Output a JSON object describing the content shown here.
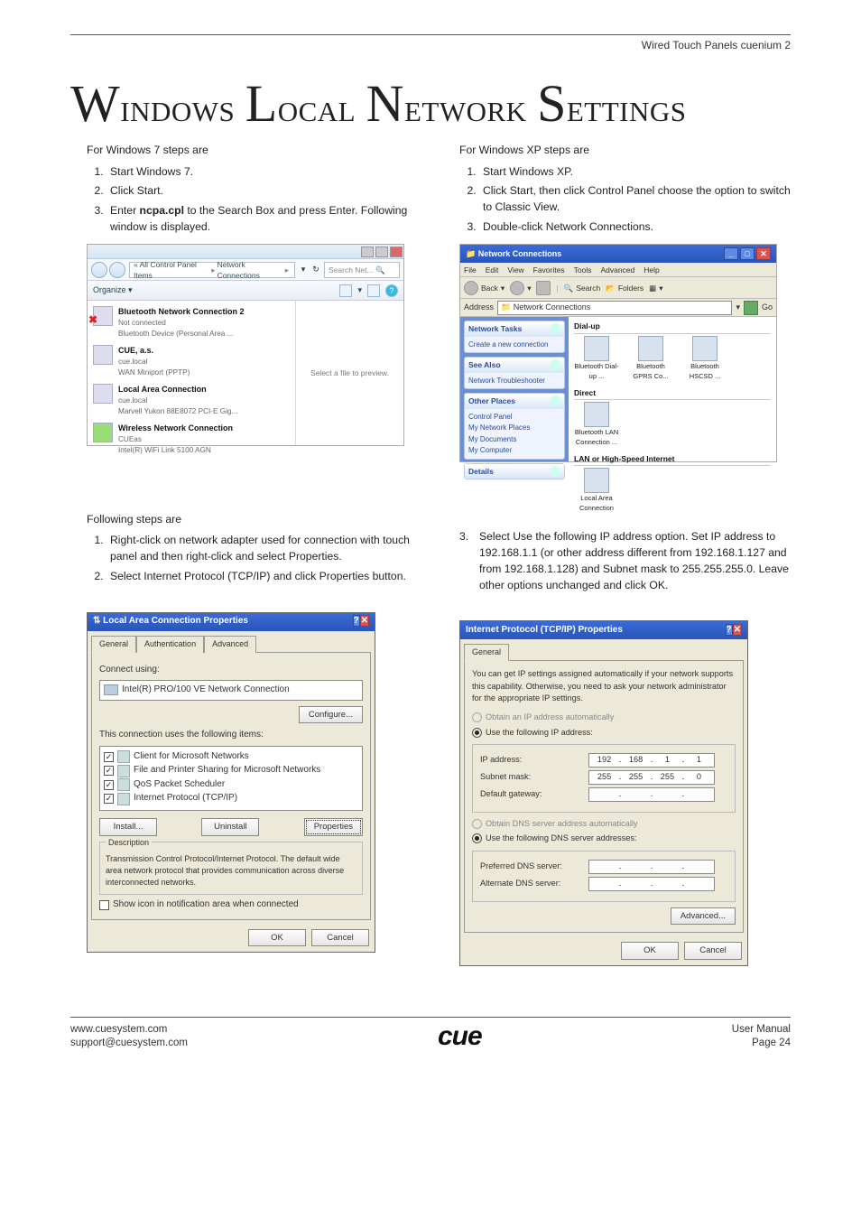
{
  "header": {
    "product": "Wired Touch Panels cuenium 2"
  },
  "title": {
    "text": "Windows Local Network Settings"
  },
  "win7": {
    "intro": "For Windows 7 steps are",
    "steps": [
      "Start Windows 7.",
      "Click Start.",
      "Enter ncpa.cpl to the Search Box and press Enter. Following window is displayed."
    ]
  },
  "xp": {
    "intro": "For Windows XP steps are",
    "steps": [
      "Start Windows XP.",
      "Click Start, then click Control Panel choose the option to switch to Classic View.",
      "Double-click Network Connections."
    ]
  },
  "win7shot": {
    "breadcrumb_prefix": "« All Control Panel Items",
    "breadcrumb_last": "Network Connections",
    "search_placeholder": "Search Net...",
    "organize": "Organize ▾",
    "items": [
      {
        "name": "Bluetooth Network Connection 2",
        "status": "Not connected",
        "desc": "Bluetooth Device (Personal Area ...",
        "redx": true
      },
      {
        "name": "CUE, a.s.",
        "status": "cue.local",
        "desc": "WAN Miniport (PPTP)",
        "redx": false
      },
      {
        "name": "Local Area Connection",
        "status": "cue.local",
        "desc": "Marvell Yukon 88E8072 PCI-E Gig...",
        "redx": false
      },
      {
        "name": "Wireless Network Connection",
        "status": "CUEas",
        "desc": "Intel(R) WiFi Link 5100 AGN",
        "redx": false
      }
    ],
    "preview": "Select a file to preview."
  },
  "xpshot": {
    "title": "Network Connections",
    "menu": [
      "File",
      "Edit",
      "View",
      "Favorites",
      "Tools",
      "Advanced",
      "Help"
    ],
    "toolbar": {
      "back": "Back",
      "search": "Search",
      "folders": "Folders"
    },
    "address_label": "Address",
    "address_value": "Network Connections",
    "go": "Go",
    "panels": {
      "tasks": {
        "title": "Network Tasks",
        "items": [
          "Create a new connection"
        ]
      },
      "see": {
        "title": "See Also",
        "items": [
          "Network Troubleshooter"
        ]
      },
      "places": {
        "title": "Other Places",
        "items": [
          "Control Panel",
          "My Network Places",
          "My Documents",
          "My Computer"
        ]
      },
      "details": {
        "title": "Details"
      }
    },
    "groups": {
      "dialup": {
        "title": "Dial-up",
        "icons": [
          "Bluetooth Dial-up ...",
          "Bluetooth GPRS Co...",
          "Bluetooth HSCSD ..."
        ]
      },
      "direct": {
        "title": "Direct",
        "icons": [
          "Bluetooth LAN Connection ..."
        ]
      },
      "lan": {
        "title": "LAN or High-Speed Internet",
        "icons": [
          "Local Area Connection"
        ]
      }
    }
  },
  "following": {
    "intro": "Following steps are",
    "left_steps": [
      "Right-click on network adapter used for connection with touch panel and then right-click and select Properties.",
      "Select Internet Protocol (TCP/IP) and click Properties button."
    ],
    "right_step_num": "3.",
    "right_step": "Select Use the following IP address option. Set IP address to 192.168.1.1 (or other address different from 192.168.1.127 and from 192.168.1.128) and Subnet mask to 255.255.255.0. Leave other options unchanged and click OK."
  },
  "lac": {
    "title": "Local Area Connection Properties",
    "tabs": [
      "General",
      "Authentication",
      "Advanced"
    ],
    "connect_using": "Connect using:",
    "adapter": "Intel(R) PRO/100 VE Network Connection",
    "configure": "Configure...",
    "uses_items": "This connection uses the following items:",
    "items": [
      "Client for Microsoft Networks",
      "File and Printer Sharing for Microsoft Networks",
      "QoS Packet Scheduler",
      "Internet Protocol (TCP/IP)"
    ],
    "install": "Install...",
    "uninstall": "Uninstall",
    "properties": "Properties",
    "desc_title": "Description",
    "desc": "Transmission Control Protocol/Internet Protocol. The default wide area network protocol that provides communication across diverse interconnected networks.",
    "show_icon": "Show icon in notification area when connected",
    "ok": "OK",
    "cancel": "Cancel"
  },
  "tcpip": {
    "title": "Internet Protocol (TCP/IP) Properties",
    "tab": "General",
    "blurb": "You can get IP settings assigned automatically if your network supports this capability. Otherwise, you need to ask your network administrator for the appropriate IP settings.",
    "obtain_auto": "Obtain an IP address automatically",
    "use_following": "Use the following IP address:",
    "ip_label": "IP address:",
    "ip": [
      "192",
      "168",
      "1",
      "1"
    ],
    "subnet_label": "Subnet mask:",
    "subnet": [
      "255",
      "255",
      "255",
      "0"
    ],
    "gateway_label": "Default gateway:",
    "gateway": [
      "",
      "",
      "",
      ""
    ],
    "dns_auto": "Obtain DNS server address automatically",
    "dns_use": "Use the following DNS server addresses:",
    "pref_dns_label": "Preferred DNS server:",
    "alt_dns_label": "Alternate DNS server:",
    "advanced": "Advanced...",
    "ok": "OK",
    "cancel": "Cancel"
  },
  "footer": {
    "url": "www.cuesystem.com",
    "email": "support@cuesystem.com",
    "brand": "cue",
    "manual": "User Manual",
    "page": "Page 24"
  }
}
